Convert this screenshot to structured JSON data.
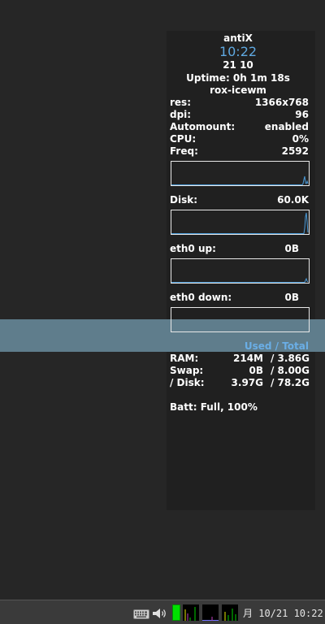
{
  "conky": {
    "hostname": "antiX",
    "time": "10:22",
    "date": " 21 10",
    "uptime": "Uptime: 0h 1m 18s",
    "wm": "rox-icewm",
    "stats": [
      {
        "label": "res:",
        "value": "1366x768"
      },
      {
        "label": "dpi:",
        "value": "96"
      },
      {
        "label": "Automount:",
        "value": "enabled"
      },
      {
        "label": "CPU:",
        "value": "0%"
      },
      {
        "label": "Freq:",
        "value": "2592"
      }
    ],
    "disk": {
      "label": "Disk:",
      "value": "60.0K"
    },
    "eth_up": {
      "label": "eth0 up:",
      "value": "0B"
    },
    "eth_down": {
      "label": "eth0 down:",
      "value": "0B"
    },
    "mem_header": "Used / Total",
    "memory": [
      {
        "label": "RAM:",
        "used": "214M",
        "total": "/ 3.86G"
      },
      {
        "label": "Swap:",
        "used": "0B",
        "total": "/ 8.00G"
      },
      {
        "label": "/ Disk:",
        "used": "3.97G",
        "total": "/ 78.2G"
      }
    ],
    "battery": "Batt: Full, 100%",
    "colors": {
      "time": "#5fa8e0",
      "header": "#6aaee6",
      "graph_line": "#4a9ad8",
      "band": "#5f7d8c"
    }
  },
  "taskbar": {
    "clock": "月 10/21 10:22",
    "icons": [
      "keyboard-icon",
      "volume-icon",
      "battery-monitor-icon",
      "cpu-monitor-icon",
      "net-monitor-icon",
      "mem-monitor-icon"
    ]
  }
}
